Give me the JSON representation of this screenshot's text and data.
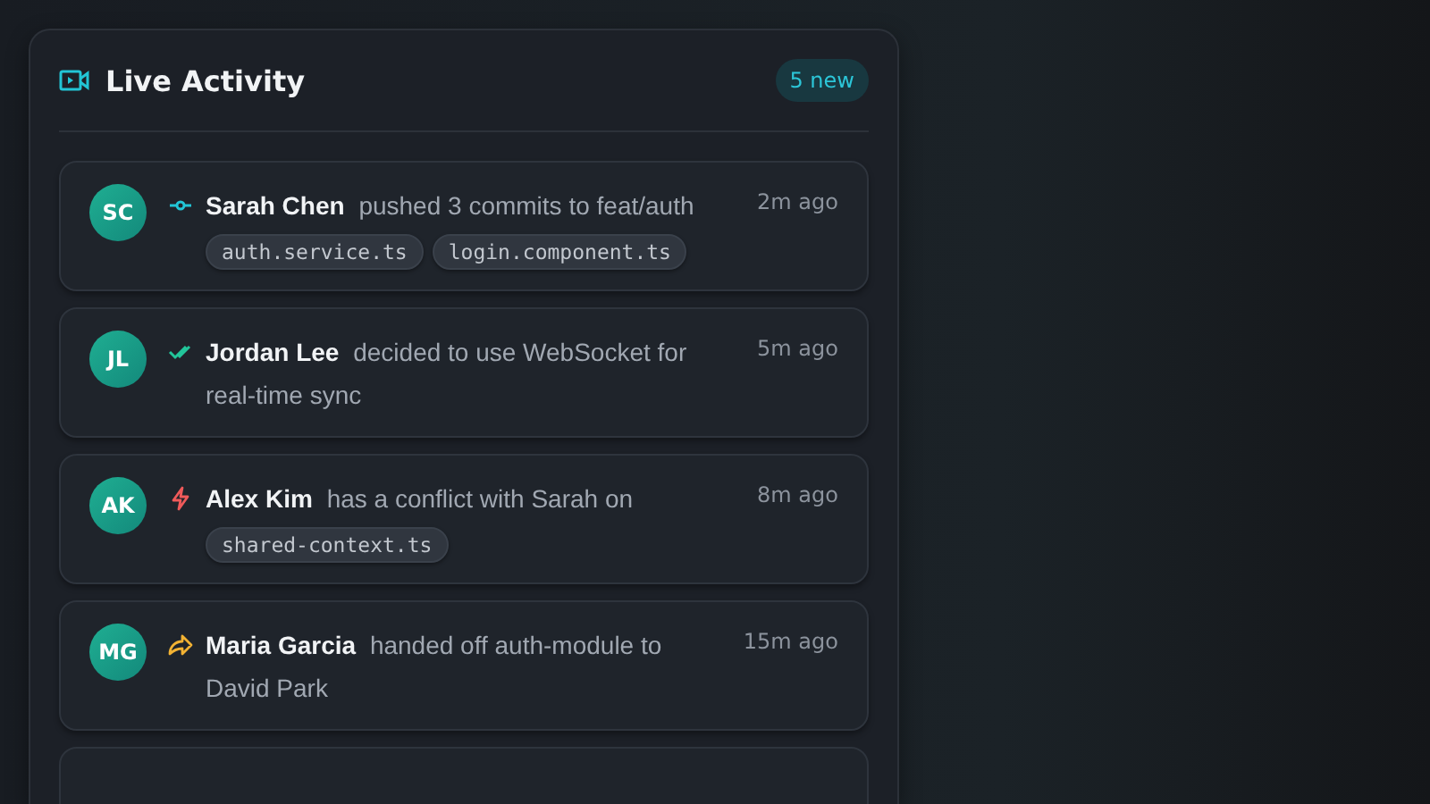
{
  "header": {
    "title": "Live Activity",
    "badge": "5 new"
  },
  "activities": [
    {
      "initials": "SC",
      "kind": "commit",
      "name": "Sarah Chen",
      "action": "pushed 3 commits to feat/auth",
      "time": "2m ago",
      "files": [
        "auth.service.ts",
        "login.component.ts"
      ]
    },
    {
      "initials": "JL",
      "kind": "decision",
      "name": "Jordan Lee",
      "action": "decided to use WebSocket for real-time sync",
      "time": "5m ago"
    },
    {
      "initials": "AK",
      "kind": "conflict",
      "name": "Alex Kim",
      "action": "has a conflict with Sarah on",
      "time": "8m ago",
      "files": [
        "shared-context.ts"
      ]
    },
    {
      "initials": "MG",
      "kind": "handoff",
      "name": "Maria Garcia",
      "action": "handed off auth-module to David Park",
      "time": "15m ago"
    }
  ]
}
